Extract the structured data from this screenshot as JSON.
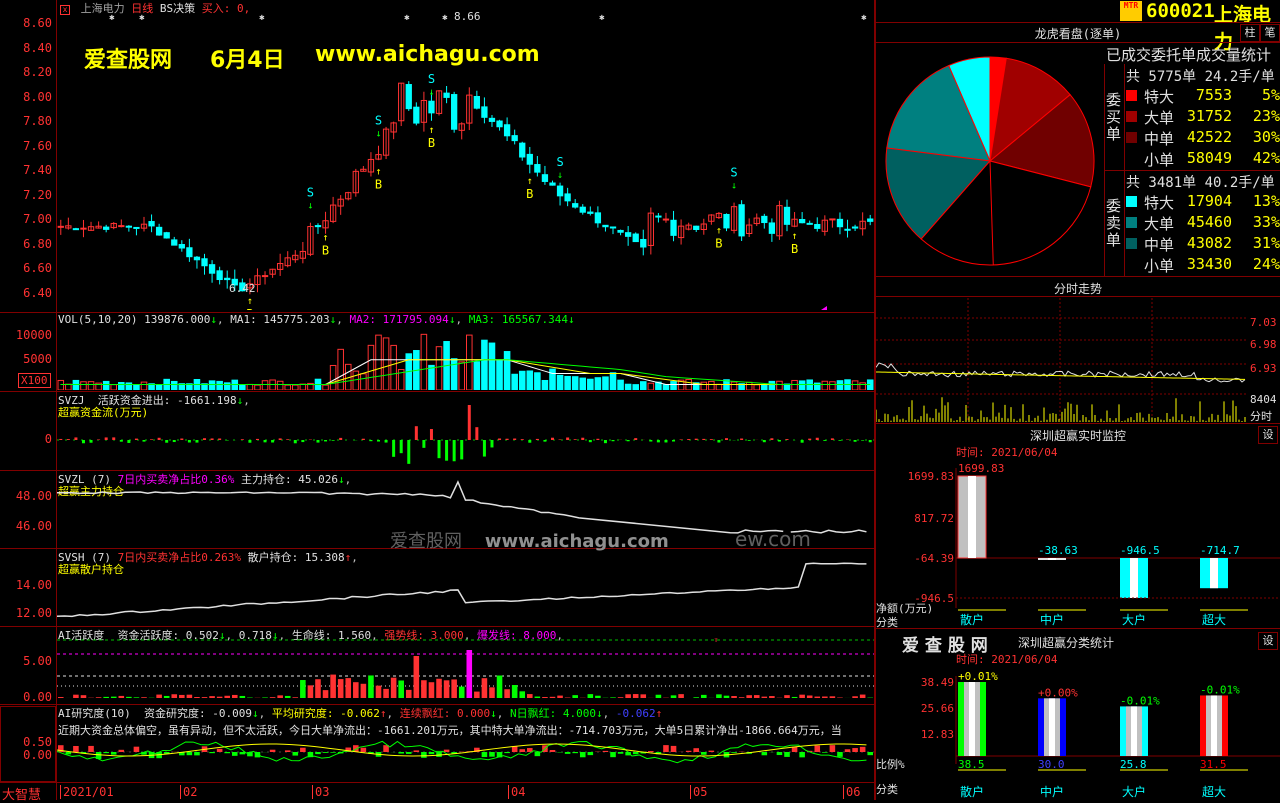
{
  "chart_header": {
    "stock_name": "上海电力",
    "period": "日线",
    "indicator": "BS决策",
    "signal": "买入: 0,"
  },
  "watermark": {
    "site_cn": "爱查股网",
    "date": "6月4日",
    "url": "www.aichagu.com",
    "center_cn": "爱查股网",
    "center_url": "www.aichagu.com",
    "center_tail": "ew.com"
  },
  "price_axis": [
    "8.60",
    "8.40",
    "8.20",
    "8.00",
    "7.80",
    "7.60",
    "7.40",
    "7.20",
    "7.00",
    "6.80",
    "6.60",
    "6.40"
  ],
  "price_marks": {
    "high": "8.66",
    "low": "6.42"
  },
  "bs_labels": {
    "buy": "B",
    "sell": "S"
  },
  "vol": {
    "title": "VOL(5,10,20)",
    "value": "139876.000",
    "ma1_label": "MA1:",
    "ma1": "145775.203",
    "ma2_label": "MA2:",
    "ma2": "171795.094",
    "ma3_label": "MA3:",
    "ma3": "165567.344",
    "axis": [
      "10000",
      "5000"
    ],
    "unit": "X100"
  },
  "svzj": {
    "title": "SVZJ",
    "name": "活跃资金进出:",
    "value": "-1661.198",
    "subtitle": "超赢资金流(万元)",
    "axis": [
      "0"
    ]
  },
  "svzl": {
    "title": "SVZL (7)",
    "ratio_label": "7日内买卖净占比",
    "ratio": "0.36%",
    "name": "主力持仓:",
    "value": "45.026",
    "subtitle": "超赢主力持仓",
    "axis": [
      "48.00",
      "46.00"
    ]
  },
  "svsh": {
    "title": "SVSH (7)",
    "ratio_label": "7日内买卖净占比",
    "ratio": "0.263%",
    "name": "散户持仓:",
    "value": "15.308",
    "subtitle": "超赢散户持仓",
    "axis": [
      "14.00",
      "12.00"
    ]
  },
  "ai_active": {
    "title": "AI活跃度",
    "l1": "资金活跃度:",
    "v1": "0.502",
    "v2": "0.718",
    "l3": "生命线:",
    "v3": "1.560",
    "l4": "强势线:",
    "v4": "3.000",
    "l5": "爆发线:",
    "v5": "8.000",
    "axis": [
      "5.00",
      "0.00"
    ]
  },
  "ai_research": {
    "title": "AI研究度(10)",
    "l1": "资金研究度:",
    "v1": "-0.009",
    "l2": "平均研究度:",
    "v2": "-0.062",
    "l3": "连续飘红:",
    "v3": "0.000",
    "l4": "N日飘红:",
    "v4": "4.000",
    "v5": "-0.062",
    "comment": "近期大资金总体偏空，虽有异动，但不太活跃，今日大单净流出：-1661.201万元，其中特大单净流出：-714.703万元，大单5日累计净出-1866.664万元，当",
    "axis": [
      "0.50",
      "0.00"
    ]
  },
  "left_corner": "大智慧",
  "x_axis": [
    "2021/01",
    "02",
    "03",
    "04",
    "05",
    "06"
  ],
  "ticker": {
    "badge": "MTR",
    "code": "600021",
    "name": "上海电力"
  },
  "dragon": {
    "title": "龙虎看盘(逐单)",
    "btn1": "柱",
    "btn2": "笔",
    "subtitle": "已成交委托单成交量统计",
    "buy_label": "委买单",
    "buy_total": "共 5775单 24.2手/单",
    "buy_rows": [
      {
        "name": "特大",
        "qty": "7553",
        "pct": "5%",
        "color": "#ff0000"
      },
      {
        "name": "大单",
        "qty": "31752",
        "pct": "23%",
        "color": "#a00000"
      },
      {
        "name": "中单",
        "qty": "42522",
        "pct": "30%",
        "color": "#700000"
      },
      {
        "name": "小单",
        "qty": "58049",
        "pct": "42%",
        "color": "#000000"
      }
    ],
    "sell_label": "委卖单",
    "sell_total": "共 3481单 40.2手/单",
    "sell_rows": [
      {
        "name": "特大",
        "qty": "17904",
        "pct": "13%",
        "color": "#00ffff"
      },
      {
        "name": "大单",
        "qty": "45460",
        "pct": "33%",
        "color": "#008080"
      },
      {
        "name": "中单",
        "qty": "43082",
        "pct": "31%",
        "color": "#006060"
      },
      {
        "name": "小单",
        "qty": "33430",
        "pct": "24%",
        "color": "#000000"
      }
    ]
  },
  "intraday": {
    "title": "分时走势",
    "axis": [
      "7.03",
      "6.98",
      "6.93"
    ],
    "vol": "8404",
    "vol_label": "分时"
  },
  "monitor": {
    "title": "深圳超赢实时监控",
    "btn": "设",
    "time": "时间: 2021/06/04",
    "axis": [
      "1699.83",
      "817.72",
      "-64.39",
      "-946.5"
    ],
    "unit": "净额(万元)",
    "cat_label": "分类",
    "bars": [
      {
        "name": "散户",
        "value": "1699.83"
      },
      {
        "name": "中户",
        "value": "-38.63"
      },
      {
        "name": "大户",
        "value": "-946.5"
      },
      {
        "name": "超大",
        "value": "-714.7"
      }
    ]
  },
  "classify": {
    "logo": "爱 查 股 网",
    "title": "深圳超赢分类统计",
    "btn": "设",
    "time": "时间: 2021/06/04",
    "axis": [
      "38.49",
      "25.66",
      "12.83"
    ],
    "unit": "比例%",
    "cat_label": "分类",
    "bars": [
      {
        "name": "散户",
        "value": "38.5",
        "change": "+0.01%"
      },
      {
        "name": "中户",
        "value": "30.0",
        "change": "+0.00%"
      },
      {
        "name": "大户",
        "value": "25.8",
        "change": "-0.01%"
      },
      {
        "name": "超大",
        "value": "31.5",
        "change": "-0.01%"
      }
    ]
  }
}
